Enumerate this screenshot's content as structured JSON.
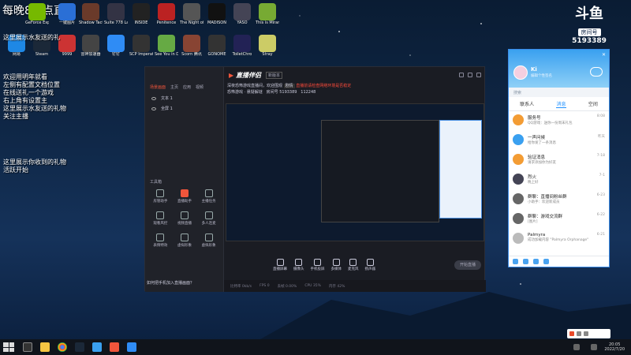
{
  "overlay": {
    "stream_title": "每晚8-2点直播",
    "lines": [
      "这里展示水友送的礼",
      "欢迎用明年就看",
      "左侧有配置文档位置",
      "在线送礼一个游戏",
      "右上角有设置主",
      "这里展示水友送的礼物",
      "关注主播",
      "这里展示你收到的礼物",
      "活跃开始"
    ]
  },
  "douyu": {
    "logo": "斗鱼",
    "sub": "房间号",
    "room": "5193389"
  },
  "desktop_icons": [
    {
      "label": "GeForce Experience",
      "color": "#76b900"
    },
    {
      "label": "一键图片",
      "color": "#2a6fd6"
    },
    {
      "label": "Shadow Tactics",
      "color": "#6a3a2a"
    },
    {
      "label": "Suite 778 Launcher",
      "color": "#334"
    },
    {
      "label": "INSIDE",
      "color": "#222"
    },
    {
      "label": "Penitence",
      "color": "#b22"
    },
    {
      "label": "The Night of the Sick",
      "color": "#555"
    },
    {
      "label": "MADISON",
      "color": "#111"
    },
    {
      "label": "YASO",
      "color": "#445"
    },
    {
      "label": "This is Miranda",
      "color": "#7a3"
    },
    {
      "label": "网易",
      "color": "#1e88e5"
    },
    {
      "label": "Steam",
      "color": "#1b2838"
    },
    {
      "label": "9999",
      "color": "#c33"
    },
    {
      "label": "雷神加速器",
      "color": "#444"
    },
    {
      "label": "钉钉",
      "color": "#2f8cf5"
    },
    {
      "label": "SCP Imperative",
      "color": "#333"
    },
    {
      "label": "See You in Delcold",
      "color": "#6a4"
    },
    {
      "label": "Scorn 腾讯",
      "color": "#843"
    },
    {
      "label": "GONOME",
      "color": "#333"
    },
    {
      "label": "ToiletChro",
      "color": "#225"
    },
    {
      "label": "Stray",
      "color": "#cc6"
    }
  ],
  "companion": {
    "logo_a": "直播伴侣",
    "version": "新版本",
    "tabs": [
      "场景画面",
      "主页",
      "应用",
      "视频"
    ],
    "scenes": [
      "文本 1",
      "全屏 1"
    ],
    "room_title": "深夜恐怖游戏直播间，欢迎围观",
    "tag": "剧情",
    "warning": "直播前请检查网络环境是否稳定",
    "category": "恐怖游戏",
    "category2": "悬疑解谜",
    "room_label": "房间号",
    "room_number": "5193389",
    "fans": "112248",
    "tool_title": "工具箱",
    "tools": [
      "房管助手",
      "直播助手",
      "主播任务",
      "观看风控",
      "视频直播",
      "多人连麦",
      "表情特效",
      "虚拟形象",
      "虚拟形象"
    ],
    "bottom": [
      "直播屏幕",
      "摄像头",
      "手机投屏",
      "多媒体",
      "麦克风",
      "扬声器"
    ],
    "start_label": "开始直播",
    "help": "如何把手机加入直播画面？",
    "status": [
      "比特率 0kb/s",
      "FPS 0",
      "丢帧 0.00%",
      "CPU 35%",
      "内存 42%"
    ]
  },
  "qq": {
    "name": "Ki",
    "sign": "编辑个性签名",
    "search": "搜索",
    "tabs": [
      "联系人",
      "消息",
      "空间"
    ],
    "active_tab": 1,
    "items": [
      {
        "name": "服务号",
        "preview": "QQ游戏：送你一份周末礼包",
        "time": "8:08",
        "color": "#f39c34"
      },
      {
        "name": "一声问候",
        "preview": "给你发了一条消息",
        "time": "昨天",
        "color": "#3aa0f0"
      },
      {
        "name": "验证消息",
        "preview": "请求添加你为好友",
        "time": "7-18",
        "color": "#f39c34"
      },
      {
        "name": "烈火",
        "preview": "晚上好",
        "time": "7-1",
        "color": "#445"
      },
      {
        "name": "群聊：直播间粉丝群",
        "preview": "小助手：欢迎新成员",
        "time": "6-23",
        "color": "#666"
      },
      {
        "name": "群聊：游戏交流群",
        "preview": "[图片]",
        "time": "6-22",
        "color": "#666"
      },
      {
        "name": "Palmyra",
        "preview": "成功加载内容 \"Palmyra Orphanage\"",
        "time": "6-21",
        "color": "#bbb"
      }
    ]
  },
  "taskbar": {
    "time": "20:05",
    "date": "2022/7/20"
  }
}
